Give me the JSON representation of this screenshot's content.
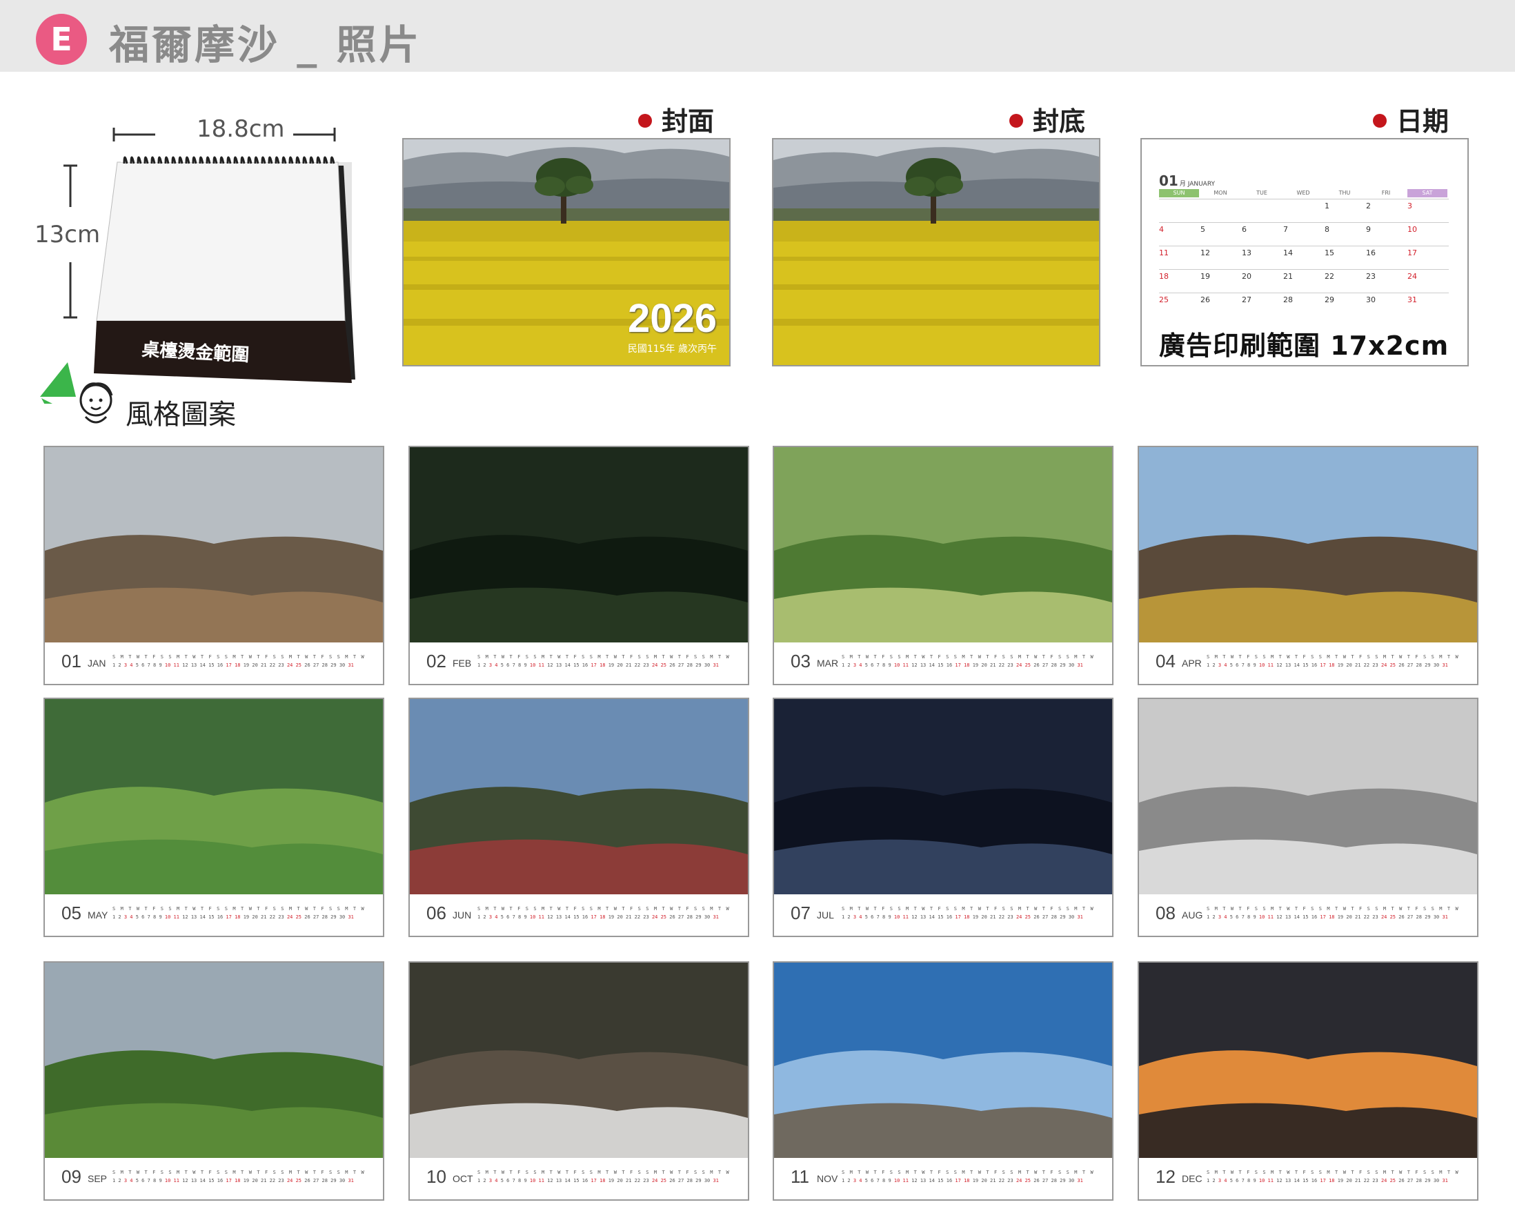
{
  "header": {
    "badge": "E",
    "title": "福爾摩沙 _ 照片"
  },
  "mockup": {
    "width_label": "18.8cm",
    "height_label": "13cm",
    "stamp_area": "桌檯燙金範圍"
  },
  "sections": {
    "cover": "封面",
    "back": "封底",
    "date": "日期"
  },
  "cover": {
    "year": "2026",
    "year_sub": "民國115年 歲次丙午"
  },
  "date_panel": {
    "month_num": "01",
    "month_small": "月 JANUARY",
    "weekdays": [
      "SUN",
      "MON",
      "TUE",
      "WED",
      "THU",
      "FRI",
      "SAT"
    ],
    "ad_text": "廣告印刷範圍 17x2cm"
  },
  "style_label": "風格圖案",
  "months": [
    {
      "num": "01",
      "abbr": "JAN"
    },
    {
      "num": "02",
      "abbr": "FEB"
    },
    {
      "num": "03",
      "abbr": "MAR"
    },
    {
      "num": "04",
      "abbr": "APR"
    },
    {
      "num": "05",
      "abbr": "MAY"
    },
    {
      "num": "06",
      "abbr": "JUN"
    },
    {
      "num": "07",
      "abbr": "JUL"
    },
    {
      "num": "08",
      "abbr": "AUG"
    },
    {
      "num": "09",
      "abbr": "SEP"
    },
    {
      "num": "10",
      "abbr": "OCT"
    },
    {
      "num": "11",
      "abbr": "NOV"
    },
    {
      "num": "12",
      "abbr": "DEC"
    }
  ],
  "colors": {
    "badge": "#ea5a83",
    "accent_red": "#c4161c",
    "header_bg": "#e8e8e8"
  }
}
